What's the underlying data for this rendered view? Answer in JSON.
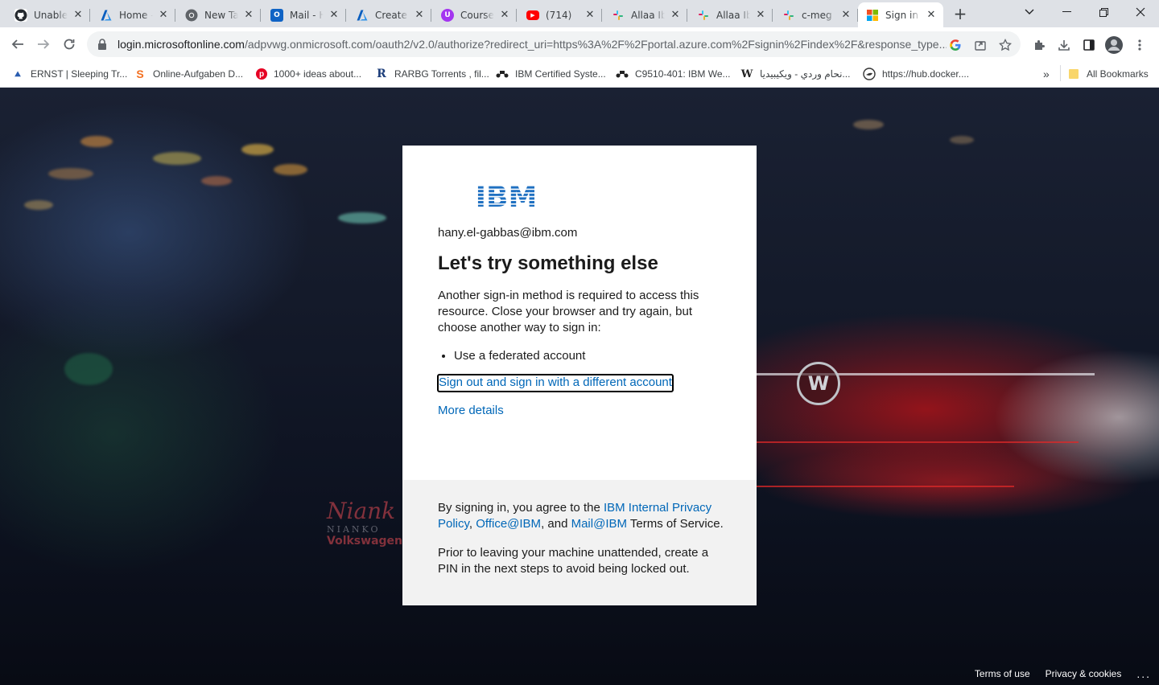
{
  "browser": {
    "tabs": [
      {
        "title": "Unable",
        "icon": "github-icon",
        "active": false
      },
      {
        "title": "Home -",
        "icon": "azure-icon",
        "active": false
      },
      {
        "title": "New Ta",
        "icon": "chrome-icon",
        "active": false
      },
      {
        "title": "Mail - H",
        "icon": "outlook-icon",
        "active": false
      },
      {
        "title": "Create",
        "icon": "azure-icon",
        "active": false
      },
      {
        "title": "Course",
        "icon": "udemy-icon",
        "active": false
      },
      {
        "title": "(714)",
        "icon": "youtube-icon",
        "active": false
      },
      {
        "title": "Allaa Ib",
        "icon": "slack-icon",
        "active": false
      },
      {
        "title": "Allaa Ib",
        "icon": "slack-icon",
        "active": false
      },
      {
        "title": "c-meg",
        "icon": "cmeg-icon",
        "active": false
      },
      {
        "title": "Sign in",
        "icon": "microsoft-icon",
        "active": true
      }
    ],
    "url_host": "login.microsoftonline.com",
    "url_path": "/adpvwg.onmicrosoft.com/oauth2/v2.0/authorize?redirect_uri=https%3A%2F%2Fportal.azure.com%2Fsignin%2Findex%2F&response_type...",
    "bookmarks": [
      {
        "label": "ERNST | Sleeping Tr...",
        "icon": "ernst-icon"
      },
      {
        "label": "Online-Aufgaben D...",
        "icon": "s-icon"
      },
      {
        "label": "1000+ ideas about...",
        "icon": "pinterest-icon"
      },
      {
        "label": "RARBG Torrents , fil...",
        "icon": "r-icon"
      },
      {
        "label": "IBM Certified Syste...",
        "icon": "network-icon"
      },
      {
        "label": "C9510-401: IBM We...",
        "icon": "network-icon"
      },
      {
        "label": "نحام وردي - ويكيبيديا...",
        "icon": "wikipedia-icon"
      },
      {
        "label": "https://hub.docker....",
        "icon": "docker-icon"
      }
    ],
    "all_bookmarks": "All Bookmarks",
    "overflow": "»"
  },
  "signin": {
    "logo": "IBM",
    "email": "hany.el-gabbas@ibm.com",
    "heading": "Let's try something else",
    "description": "Another sign-in method is required to access this resource. Close your browser and try again, but choose another way to sign in:",
    "methods": [
      "Use a federated account"
    ],
    "signout_link": "Sign out and sign in with a different account",
    "more_details": "More details",
    "policy_prefix": "By signing in, you agree to the ",
    "policy_link1": "IBM Internal Privacy Policy",
    "policy_sep1": ", ",
    "policy_link2": "Office@IBM",
    "policy_sep2": ", and ",
    "policy_link3": "Mail@IBM",
    "policy_suffix": " Terms of Service.",
    "pin_note": "Prior to leaving your machine unattended, create a PIN in the next steps to avoid being locked out."
  },
  "background": {
    "watermark_signature": "Niank",
    "watermark_name": "NIANKO",
    "watermark_brand": "Volkswagen"
  },
  "footer": {
    "terms": "Terms of use",
    "privacy": "Privacy & cookies",
    "more": "..."
  },
  "colors": {
    "link": "#0067b8",
    "ibm_blue": "#1f70c1",
    "card_footer": "#f2f2f2"
  }
}
